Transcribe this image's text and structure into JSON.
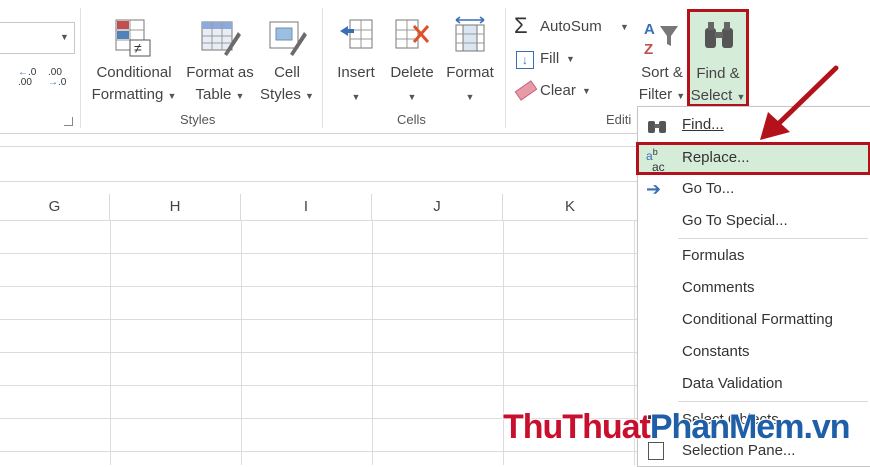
{
  "ribbon": {
    "number_format": {
      "inc_decimal": "←.0\n.00",
      "dec_decimal": ".00\n→.0"
    },
    "styles": {
      "conditional_formatting": [
        "Conditional",
        "Formatting"
      ],
      "format_as_table": [
        "Format as",
        "Table"
      ],
      "cell_styles": [
        "Cell",
        "Styles"
      ],
      "group_label": "Styles"
    },
    "cells": {
      "insert": "Insert",
      "delete": "Delete",
      "format": "Format",
      "group_label": "Cells"
    },
    "editing": {
      "autosum": "AutoSum",
      "fill": "Fill",
      "clear": "Clear",
      "sort_filter": [
        "Sort &",
        "Filter"
      ],
      "find_select": [
        "Find &",
        "Select"
      ],
      "group_label": "Editi"
    }
  },
  "columns": [
    "G",
    "H",
    "I",
    "J",
    "K"
  ],
  "menu": {
    "items": [
      {
        "label": "Find...",
        "icon": "binoculars-icon"
      },
      {
        "label": "Replace...",
        "icon": "replace-icon"
      },
      {
        "label": "Go To...",
        "icon": "arrow-right-icon"
      },
      {
        "label": "Go To Special...",
        "icon": ""
      },
      {
        "label": "Formulas",
        "icon": ""
      },
      {
        "label": "Comments",
        "icon": ""
      },
      {
        "label": "Conditional Formatting",
        "icon": ""
      },
      {
        "label": "Constants",
        "icon": ""
      },
      {
        "label": "Data Validation",
        "icon": ""
      },
      {
        "label": "Select Objects",
        "icon": "pointer-icon"
      },
      {
        "label": "Selection Pane...",
        "icon": "selection-pane-icon"
      }
    ]
  },
  "watermark": {
    "part1": "ThuThuat",
    "part2": "PhanMem",
    "part3": ".vn"
  },
  "colors": {
    "highlight": "#b3121a",
    "menu_hover": "#d5ecd9",
    "watermark_red": "#c8102e",
    "watermark_blue": "#1f5fa8"
  }
}
